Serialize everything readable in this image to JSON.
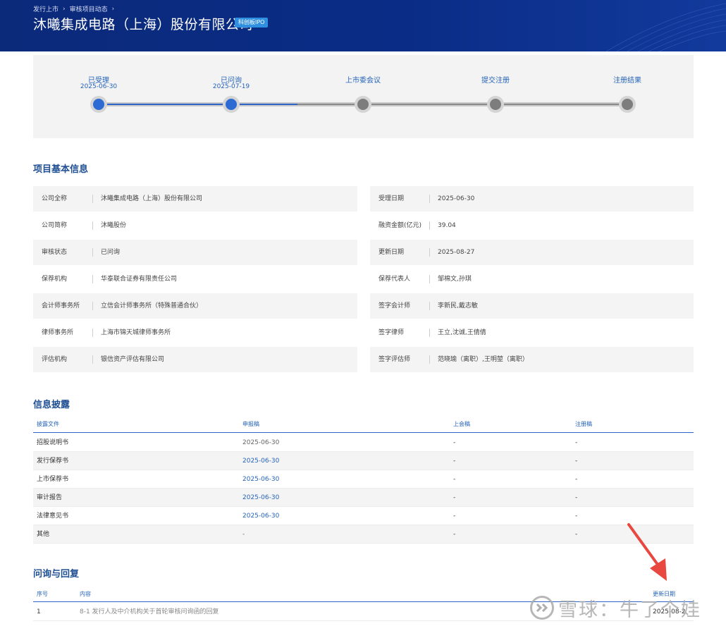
{
  "header": {
    "breadcrumbs": [
      "发行上市",
      "审核项目动态"
    ],
    "title": "沐曦集成电路（上海）股份有限公司",
    "badge": "科创板IPO"
  },
  "progress": {
    "steps": [
      {
        "label": "已受理",
        "date": "2025-06-30",
        "status": "done"
      },
      {
        "label": "已问询",
        "date": "2025-07-19",
        "status": "done"
      },
      {
        "label": "上市委会议",
        "date": "",
        "status": "pending"
      },
      {
        "label": "提交注册",
        "date": "",
        "status": "pending"
      },
      {
        "label": "注册结果",
        "date": "",
        "status": "pending"
      }
    ]
  },
  "basic_info": {
    "title": "项目基本信息",
    "left": [
      {
        "key": "公司全称",
        "value": "沐曦集成电路（上海）股份有限公司"
      },
      {
        "key": "公司简称",
        "value": "沐曦股份"
      },
      {
        "key": "审核状态",
        "value": "已问询"
      },
      {
        "key": "保荐机构",
        "value": "华泰联合证券有限责任公司"
      },
      {
        "key": "会计师事务所",
        "value": "立信会计师事务所（特殊普通合伙）"
      },
      {
        "key": "律师事务所",
        "value": "上海市锦天城律师事务所"
      },
      {
        "key": "评估机构",
        "value": "银信资产评估有限公司"
      }
    ],
    "right": [
      {
        "key": "受理日期",
        "value": "2025-06-30"
      },
      {
        "key": "融资金额(亿元)",
        "value": "39.04"
      },
      {
        "key": "更新日期",
        "value": "2025-08-27"
      },
      {
        "key": "保荐代表人",
        "value": "邹棉文,孙琪"
      },
      {
        "key": "签字会计师",
        "value": "李新民,戴志敏"
      },
      {
        "key": "签字律师",
        "value": "王立,沈诚,王倩倩"
      },
      {
        "key": "签字评估师",
        "value": "范晓瑜（离职）,王明堃（离职）"
      }
    ]
  },
  "disclosure": {
    "title": "信息披露",
    "columns": [
      "披露文件",
      "申报稿",
      "上会稿",
      "注册稿"
    ],
    "rows": [
      {
        "name": "招股说明书",
        "filing": "2025-06-30",
        "meeting": "-",
        "registration": "-"
      },
      {
        "name": "发行保荐书",
        "filing": "2025-06-30",
        "meeting": "-",
        "registration": "-"
      },
      {
        "name": "上市保荐书",
        "filing": "2025-06-30",
        "meeting": "-",
        "registration": "-"
      },
      {
        "name": "审计报告",
        "filing": "2025-06-30",
        "meeting": "-",
        "registration": "-"
      },
      {
        "name": "法律意见书",
        "filing": "2025-06-30",
        "meeting": "-",
        "registration": "-"
      },
      {
        "name": "其他",
        "filing": "-",
        "meeting": "-",
        "registration": "-"
      }
    ]
  },
  "qa": {
    "title": "问询与回复",
    "columns": [
      "序号",
      "内容",
      "更新日期"
    ],
    "rows": [
      {
        "no": "1",
        "content": "8-1 发行人及中介机构关于首轮审核问询函的回复",
        "date": "2025-08-2"
      }
    ]
  },
  "watermark": {
    "text": "雪球：牛了个娃"
  },
  "colors": {
    "brand_blue": "#0b2a7a",
    "link_blue": "#2563b8",
    "accent_red": "#e8483f"
  }
}
